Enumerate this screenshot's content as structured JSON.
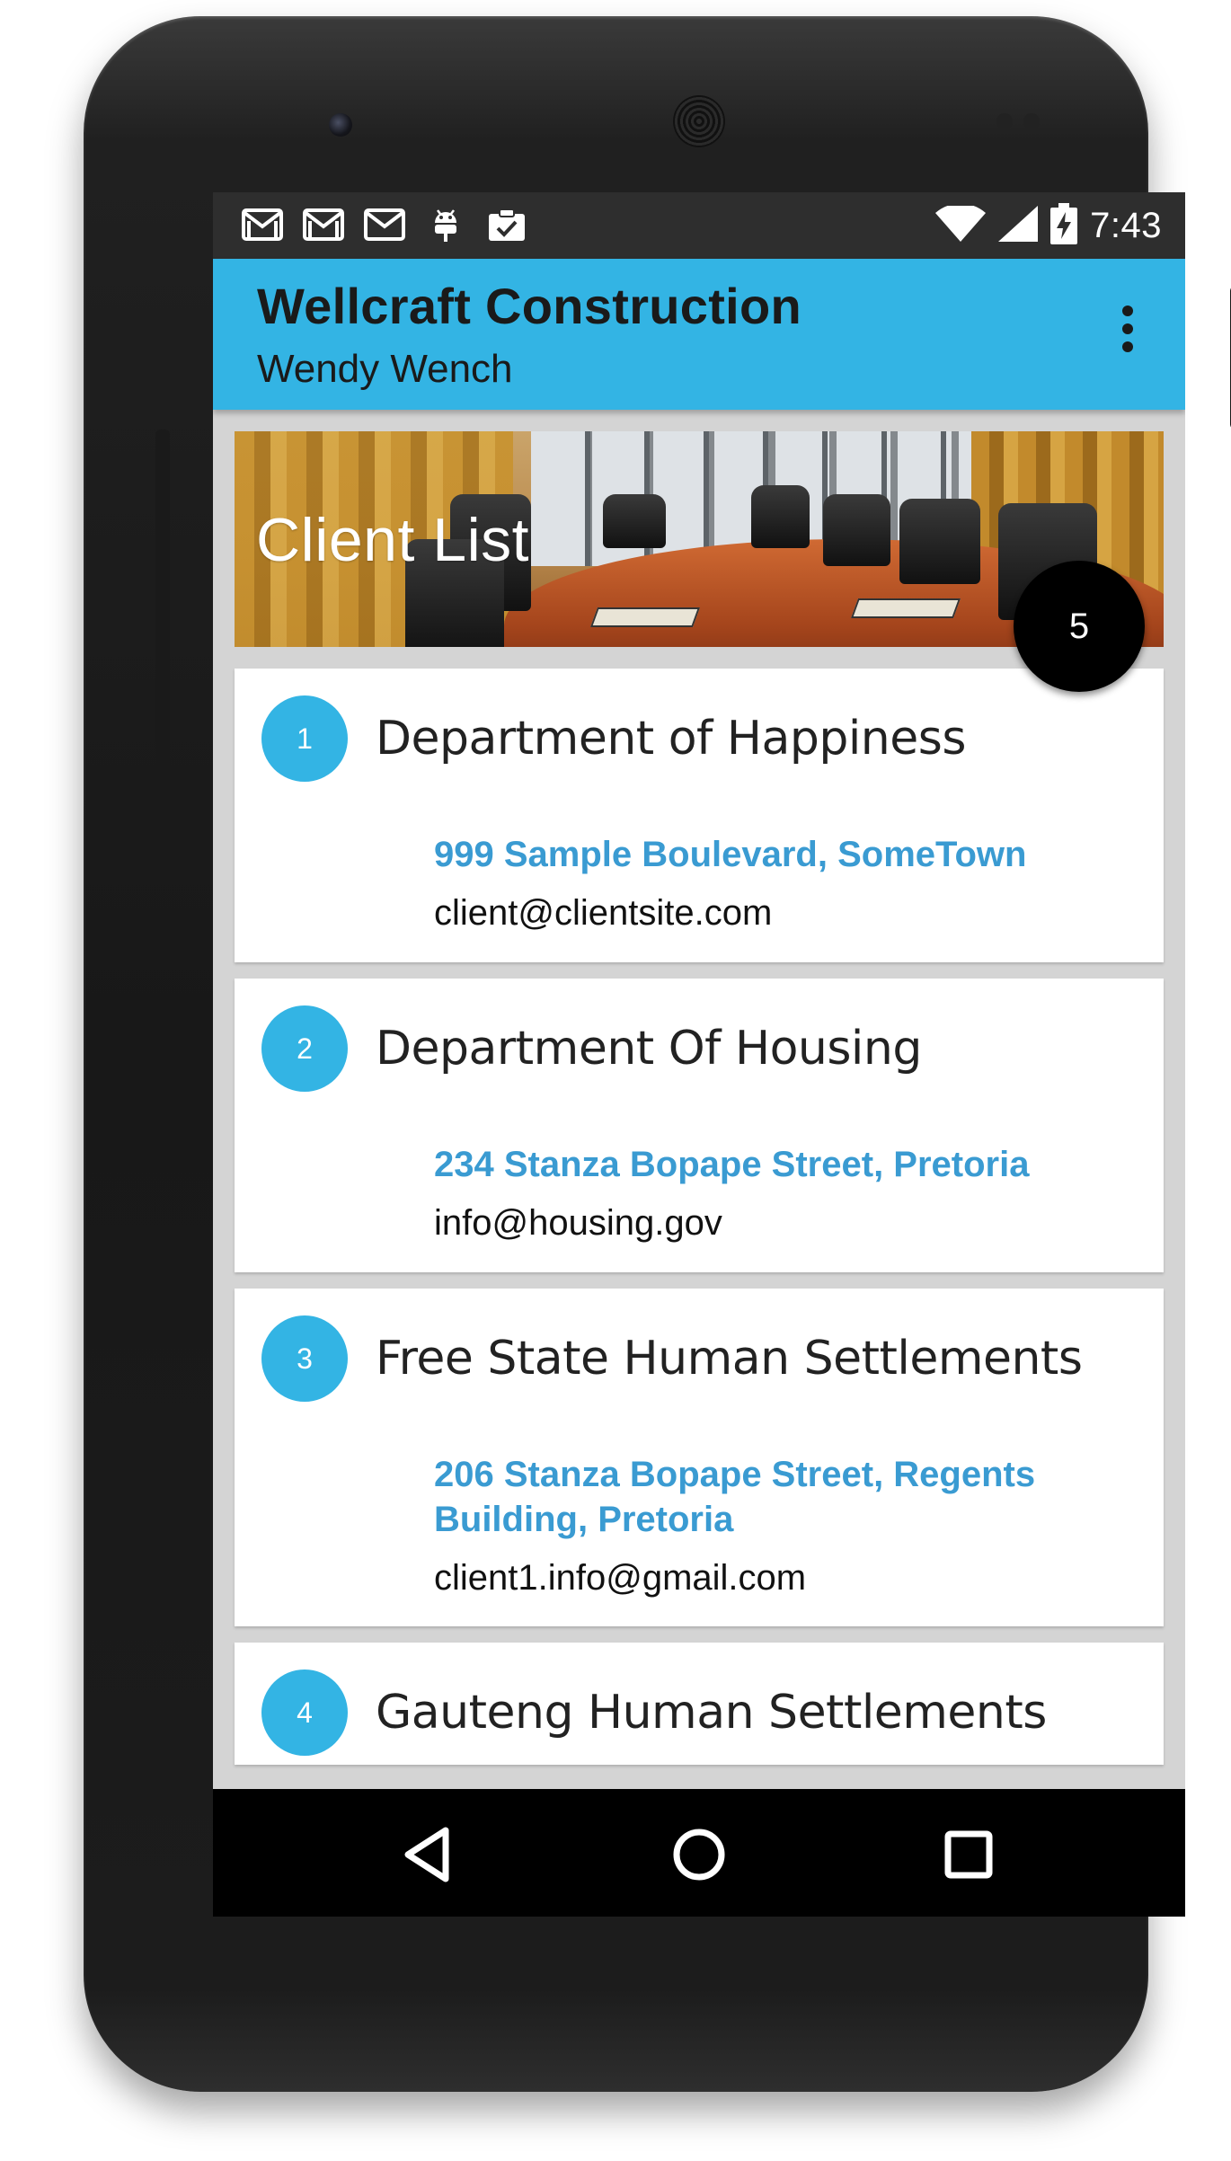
{
  "status_bar": {
    "time": "7:43",
    "left_icons": [
      "gmail-icon",
      "gmail-icon",
      "gmail-icon",
      "android-debug-icon",
      "clipboard-check-icon"
    ],
    "right_icons": [
      "wifi-icon",
      "signal-icon",
      "battery-charging-icon"
    ]
  },
  "app_bar": {
    "title": "Wellcraft Construction",
    "subtitle": "Wendy Wench",
    "menu_icon": "overflow-menu-icon"
  },
  "header": {
    "title": "Client List"
  },
  "fab": {
    "count": "5"
  },
  "clients": [
    {
      "number": "1",
      "name": "Department of Happiness",
      "address": "999 Sample Boulevard, SomeTown",
      "email": "client@clientsite.com"
    },
    {
      "number": "2",
      "name": "Department Of Housing",
      "address": "234 Stanza Bopape Street, Pretoria",
      "email": "info@housing.gov"
    },
    {
      "number": "3",
      "name": "Free State Human Settlements",
      "address": "206 Stanza Bopape Street, Regents Building, Pretoria",
      "email": "client1.info@gmail.com"
    },
    {
      "number": "4",
      "name": "Gauteng Human Settlements",
      "address": "",
      "email": ""
    }
  ],
  "nav_bar": {
    "icons": [
      "back-icon",
      "home-icon",
      "recents-icon"
    ]
  },
  "colors": {
    "app_bar": "#33b4e4",
    "accent_badge": "#33b4e4",
    "address_text": "#3a9bd2",
    "status_bar": "#2e2e2e",
    "nav_bar": "#000000",
    "fab": "#000000"
  }
}
